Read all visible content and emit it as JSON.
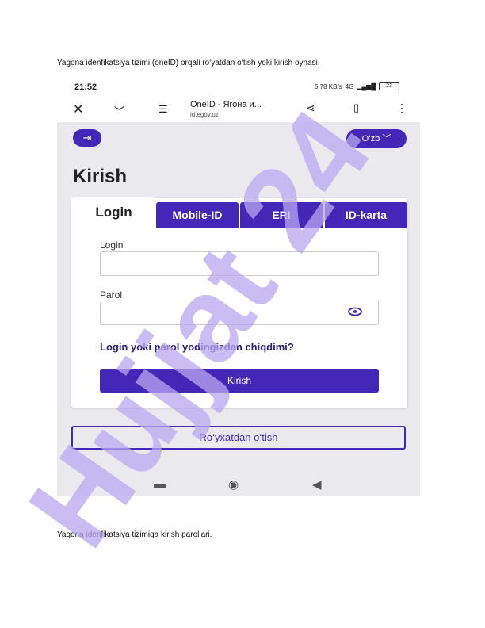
{
  "document": {
    "caption_top": "Yagona idenfikatsiya tizimi (oneID) orqali ro‘yatdan o‘tish yoki kirish oynasi.",
    "caption_bottom": "Yagona idenfikatsiya  tizimiga kirish parollari."
  },
  "phone": {
    "status": {
      "time": "21:52",
      "network": "5,78 KB/s",
      "signal": "4G",
      "battery": "23"
    },
    "browser": {
      "title": "OneID - Ягона и...",
      "host": "id.egov.uz"
    },
    "page": {
      "language": "O‘zb",
      "heading": "Kirish",
      "tabs": [
        "Login",
        "Mobile-ID",
        "ERI",
        "ID-karta"
      ],
      "login_label": "Login",
      "password_label": "Parol",
      "forgot_link": "Login yoki parol yodingizdan chiqdimi?",
      "submit_label": "Kirish",
      "register_label": "Ro‘yxatdan o‘tish"
    }
  },
  "watermark": {
    "text": "Hujjat 24",
    "color": "#b9a7f0"
  },
  "colors": {
    "brand": "#4527b8",
    "screen_bg": "#e9e9ee"
  }
}
